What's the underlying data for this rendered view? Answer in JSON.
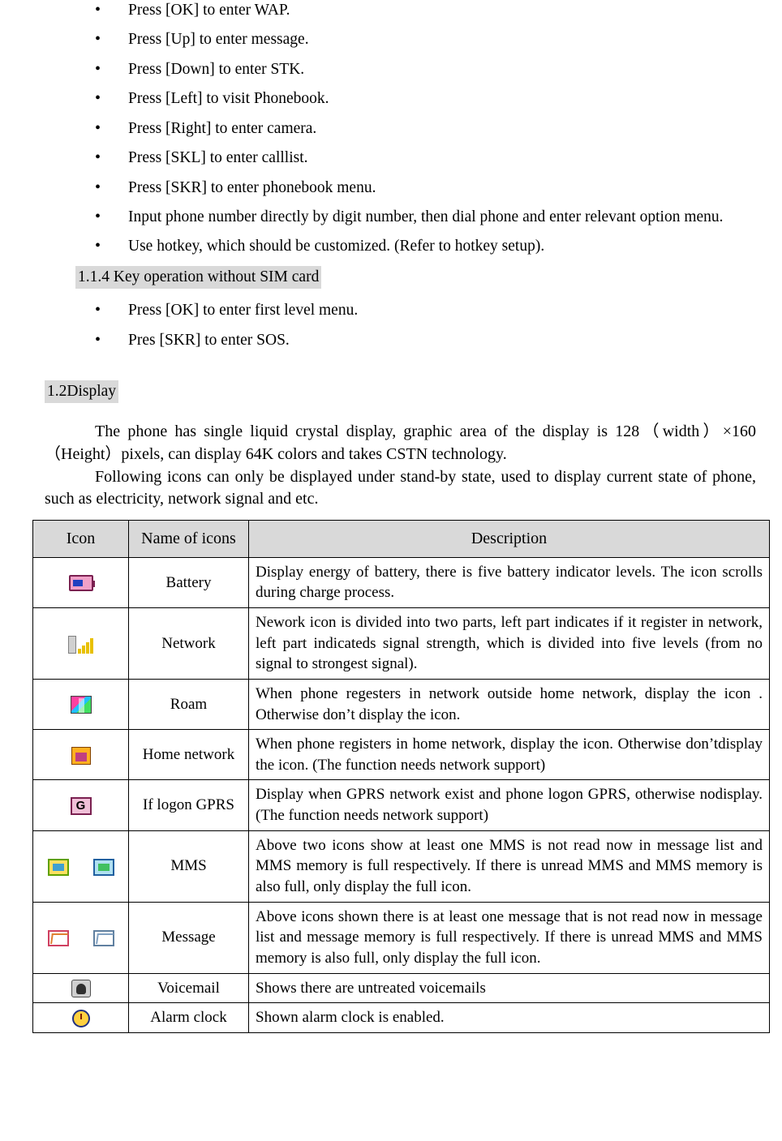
{
  "bullets_top": [
    "Press [OK] to enter WAP.",
    "Press [Up] to enter message.",
    "Press [Down] to enter STK.",
    "Press [Left] to visit Phonebook.",
    "Press [Right] to enter camera.",
    "Press [SKL] to enter calllist.",
    "Press [SKR] to enter phonebook menu.",
    "Input phone number directly by digit number, then dial phone and enter relevant option menu.",
    "Use hotkey, which should be customized. (Refer to hotkey setup)."
  ],
  "section_1_1_4": {
    "heading": "1.1.4 Key operation without SIM card",
    "bullets": [
      "Press [OK] to enter first level menu.",
      "Pres [SKR] to enter SOS."
    ]
  },
  "section_1_2": {
    "heading": "1.2Display",
    "paragraph_1": "The phone has single liquid crystal display, graphic area of the display is 128（width）×160（Height）pixels, can display 64K colors and takes CSTN technology.",
    "paragraph_2": "Following icons can only be displayed under stand-by state, used to display current state of phone, such as electricity, network signal and etc."
  },
  "table": {
    "headers": [
      "Icon",
      "Name of icons",
      "Description"
    ],
    "rows": [
      {
        "icon": "battery-icon",
        "name": "Battery",
        "description": "Display energy of battery, there is five battery indicator levels. The icon scrolls during charge process."
      },
      {
        "icon": "network-signal-icon",
        "name": "Network",
        "description": "Nework icon is divided into two parts, left part indicates if it register in network, left part indicateds signal strength, which is divided into five levels (from no signal to strongest signal)."
      },
      {
        "icon": "roam-icon",
        "name": "Roam",
        "description": "When phone regesters in network outside home network, display the icon . Otherwise don’t display the icon."
      },
      {
        "icon": "home-network-icon",
        "name": "Home network",
        "description": "When phone registers in home network, display the icon. Otherwise don’tdisplay the icon. (The function needs network support)"
      },
      {
        "icon": "gprs-icon",
        "name": "If logon GPRS",
        "description": "Display when GPRS network exist and phone logon GPRS, otherwise nodisplay. (The function needs network support)"
      },
      {
        "icon": "mms-icon",
        "name": "MMS",
        "description": "Above two icons show at least one MMS is not read now in message list and MMS memory is full respectively. If there is unread MMS and MMS memory is also full, only display the full icon."
      },
      {
        "icon": "message-icon",
        "name": "Message",
        "description": "Above icons shown there is at least one message that is not read now in message list and message memory is full respectively. If there is unread MMS and MMS memory is also full, only display the full icon."
      },
      {
        "icon": "voicemail-icon",
        "name": "Voicemail",
        "description": "Shows there are untreated voicemails"
      },
      {
        "icon": "alarm-clock-icon",
        "name": "Alarm clock",
        "description": "Shown alarm clock is enabled."
      }
    ]
  }
}
